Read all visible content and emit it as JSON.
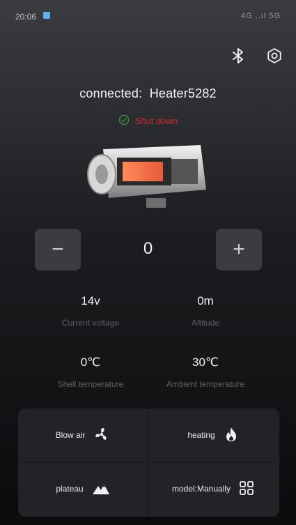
{
  "status_bar": {
    "time": "20:06",
    "icons_text": "4G ..ıl 5G"
  },
  "header": {
    "bluetooth_icon": "bluetooth-icon",
    "settings_icon": "settings-gear-icon"
  },
  "connection": {
    "label": "connected:",
    "device": "Heater5282",
    "state": "Shut down",
    "state_color": "#d32a2a"
  },
  "control": {
    "minus_label": "−",
    "plus_label": "+",
    "level": "0"
  },
  "metrics": {
    "voltage": {
      "value": "14v",
      "label": "Current voltage"
    },
    "altitude": {
      "value": "0m",
      "label": "Altitude"
    },
    "shell": {
      "value": "0℃",
      "label": "Shell temperature"
    },
    "ambient": {
      "value": "30℃",
      "label": "Ambient temperature"
    }
  },
  "modes": {
    "blow": "Blow air",
    "heating": "heating",
    "plateau": "plateau",
    "model": "model:Manually"
  }
}
